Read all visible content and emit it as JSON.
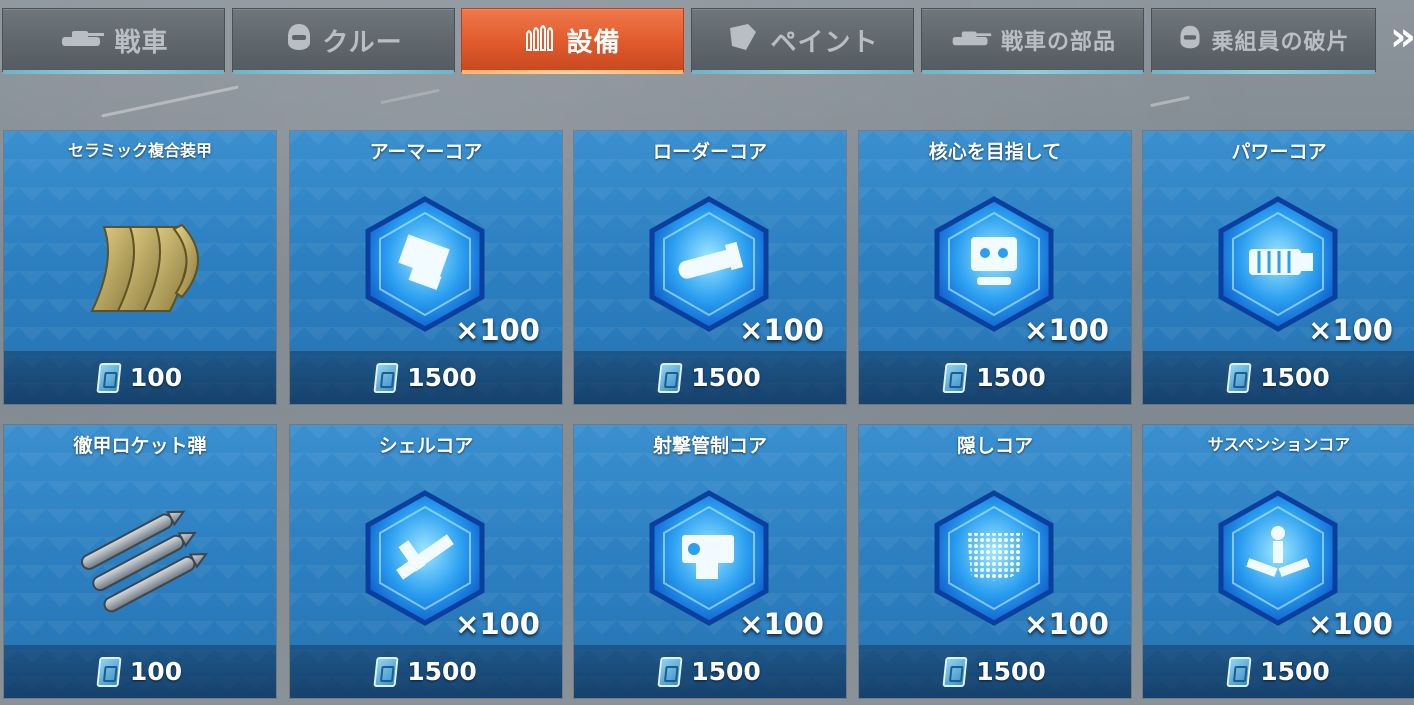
{
  "tabs": [
    {
      "label": "戦車",
      "icon": "tank-icon",
      "active": false
    },
    {
      "label": "クルー",
      "icon": "crew-helmet-icon",
      "active": false
    },
    {
      "label": "設備",
      "icon": "ammo-rounds-icon",
      "active": true
    },
    {
      "label": "ペイント",
      "icon": "paint-icon",
      "active": false
    },
    {
      "label": "戦車の部品",
      "icon": "tank-icon",
      "active": false
    },
    {
      "label": "乗組員の破片",
      "icon": "crew-helmet-icon",
      "active": false
    }
  ],
  "more_label": "»",
  "items": [
    {
      "name": "セラミック複合装甲",
      "qty": "",
      "price": "100",
      "art": "armor-plates-icon"
    },
    {
      "name": "アーマーコア",
      "qty": "×100",
      "price": "1500",
      "art": "armor-core-icon"
    },
    {
      "name": "ローダーコア",
      "qty": "×100",
      "price": "1500",
      "art": "loader-core-icon"
    },
    {
      "name": "核心を目指して",
      "qty": "×100",
      "price": "1500",
      "art": "aim-core-icon"
    },
    {
      "name": "パワーコア",
      "qty": "×100",
      "price": "1500",
      "art": "power-core-icon"
    },
    {
      "name": "徹甲ロケット弾",
      "qty": "",
      "price": "100",
      "art": "rockets-icon"
    },
    {
      "name": "シェルコア",
      "qty": "×100",
      "price": "1500",
      "art": "shell-core-icon"
    },
    {
      "name": "射撃管制コア",
      "qty": "×100",
      "price": "1500",
      "art": "fire-control-core-icon"
    },
    {
      "name": "隠しコア",
      "qty": "×100",
      "price": "1500",
      "art": "stealth-core-icon"
    },
    {
      "name": "サスペンションコア",
      "qty": "×100",
      "price": "1500",
      "art": "suspension-core-icon"
    }
  ],
  "currency_icon": "blue-card-currency-icon"
}
